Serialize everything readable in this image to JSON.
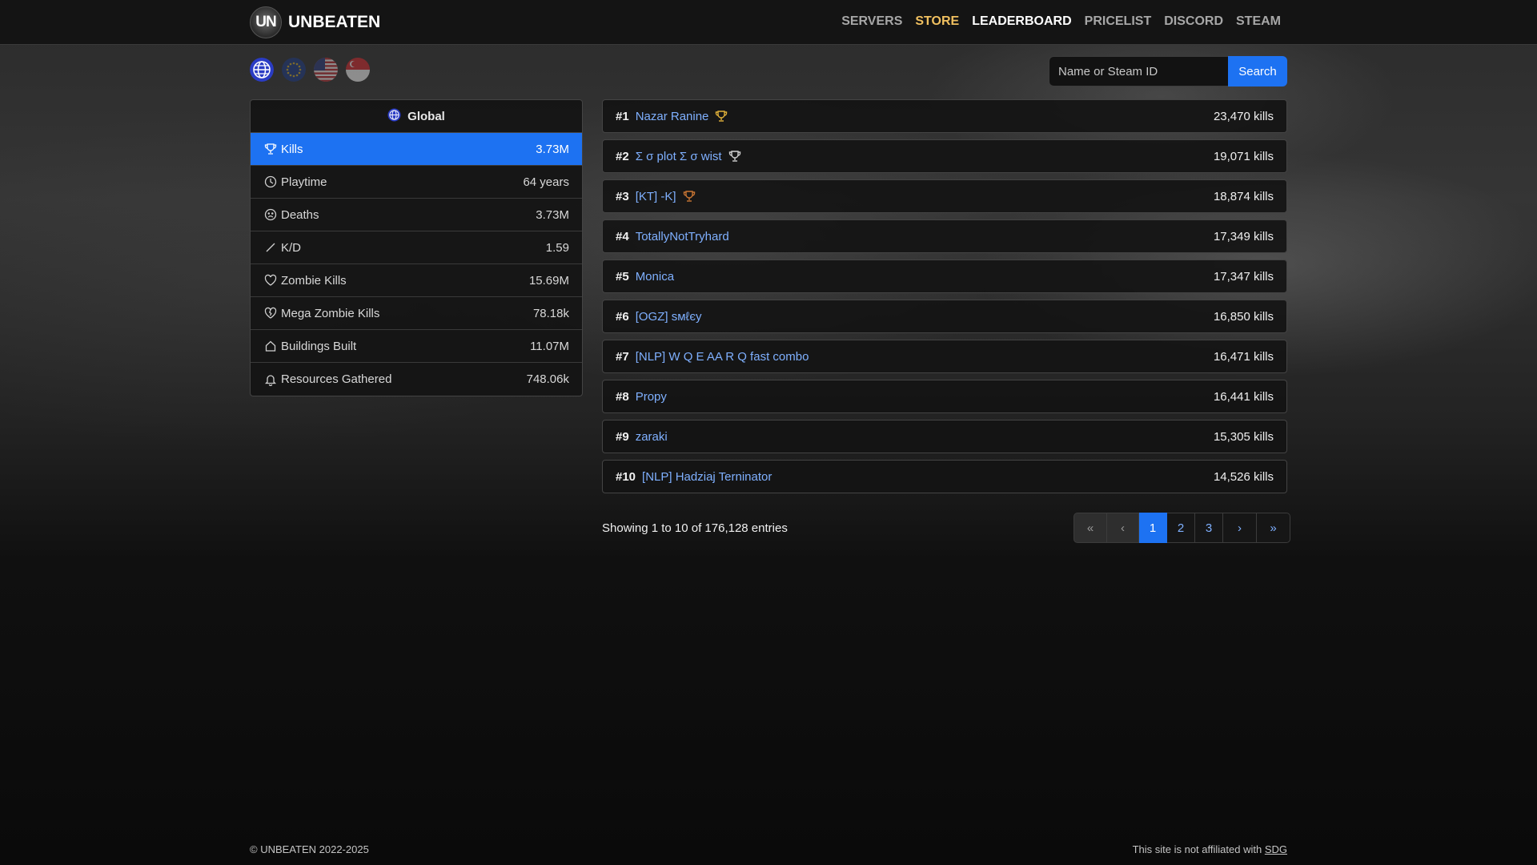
{
  "brand": {
    "logo_text": "UN",
    "name": "UNBEATEN"
  },
  "nav": {
    "servers": "SERVERS",
    "store": "STORE",
    "leaderboard": "LEADERBOARD",
    "pricelist": "PRICELIST",
    "discord": "DISCORD",
    "steam": "STEAM"
  },
  "regions": [
    "global-icon",
    "eu-flag-icon",
    "us-flag-icon",
    "sg-flag-icon"
  ],
  "search": {
    "placeholder": "Name or Steam ID",
    "button": "Search"
  },
  "stats": {
    "header": "Global",
    "items": [
      {
        "label": "Kills",
        "value": "3.73M",
        "icon": "trophy-icon"
      },
      {
        "label": "Playtime",
        "value": "64 years",
        "icon": "clock-icon"
      },
      {
        "label": "Deaths",
        "value": "3.73M",
        "icon": "sad-face-icon"
      },
      {
        "label": "K/D",
        "value": "1.59",
        "icon": "slash-icon"
      },
      {
        "label": "Zombie Kills",
        "value": "15.69M",
        "icon": "heart-icon"
      },
      {
        "label": "Mega Zombie Kills",
        "value": "78.18k",
        "icon": "broken-heart-icon"
      },
      {
        "label": "Buildings Built",
        "value": "11.07M",
        "icon": "house-icon"
      },
      {
        "label": "Resources Gathered",
        "value": "748.06k",
        "icon": "bell-icon"
      }
    ]
  },
  "leaderboard": [
    {
      "rank": "#1",
      "name": "Nazar Ranine",
      "kills": "23,470 kills",
      "trophy": "gold"
    },
    {
      "rank": "#2",
      "name": "Σ σ plot Σ σ wist",
      "kills": "19,071 kills",
      "trophy": "silver"
    },
    {
      "rank": "#3",
      "name": "[KT] -K]",
      "kills": "18,874 kills",
      "trophy": "bronze"
    },
    {
      "rank": "#4",
      "name": "TotallyNotTryhard",
      "kills": "17,349 kills"
    },
    {
      "rank": "#5",
      "name": "Monica",
      "kills": "17,347 kills"
    },
    {
      "rank": "#6",
      "name": "[OGZ] sмℓєу",
      "kills": "16,850 kills"
    },
    {
      "rank": "#7",
      "name": "[NLP] W Q E AA R Q fast combo",
      "kills": "16,471 kills"
    },
    {
      "rank": "#8",
      "name": "Propy",
      "kills": "16,441 kills"
    },
    {
      "rank": "#9",
      "name": "zaraki",
      "kills": "15,305 kills"
    },
    {
      "rank": "#10",
      "name": "[NLP] Hadziaj Terninator",
      "kills": "14,526 kills"
    }
  ],
  "showing": "Showing 1 to 10 of 176,128 entries",
  "pagination": {
    "first": "«",
    "prev": "‹",
    "pages": [
      "1",
      "2",
      "3"
    ],
    "next": "›",
    "last": "»",
    "current": "1"
  },
  "footer": {
    "copyright": "© UNBEATEN 2022-2025",
    "disclaimer": "This site is not affiliated with",
    "link": "SDG"
  },
  "colors": {
    "accent": "#1d72f2",
    "link": "#7fb0ff",
    "store": "#f0c060",
    "gold": "#e0b13a",
    "silver": "#cfcfcf",
    "bronze": "#c87533"
  }
}
